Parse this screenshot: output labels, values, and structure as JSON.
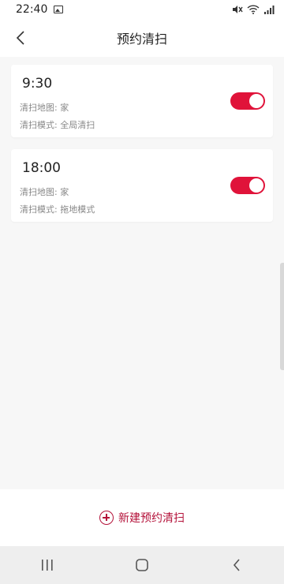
{
  "status_bar": {
    "time": "22:40",
    "icons": [
      "image-icon",
      "mute-icon",
      "wifi-icon",
      "signal-icon"
    ]
  },
  "header": {
    "back_icon": "chevron-left-icon",
    "title": "预约清扫"
  },
  "schedules": [
    {
      "time": "9:30",
      "map": "清扫地图: 家",
      "mode": "清扫模式: 全局清扫",
      "enabled": true
    },
    {
      "time": "18:00",
      "map": "清扫地图: 家",
      "mode": "清扫模式: 拖地模式",
      "enabled": true
    }
  ],
  "bottom": {
    "add_icon": "plus-circle-icon",
    "add_label": "新建预约清扫"
  },
  "nav": {
    "icons": [
      "recent-apps-icon",
      "home-icon",
      "back-icon"
    ]
  },
  "colors": {
    "accent": "#e0133a",
    "add_text": "#b4123a"
  }
}
